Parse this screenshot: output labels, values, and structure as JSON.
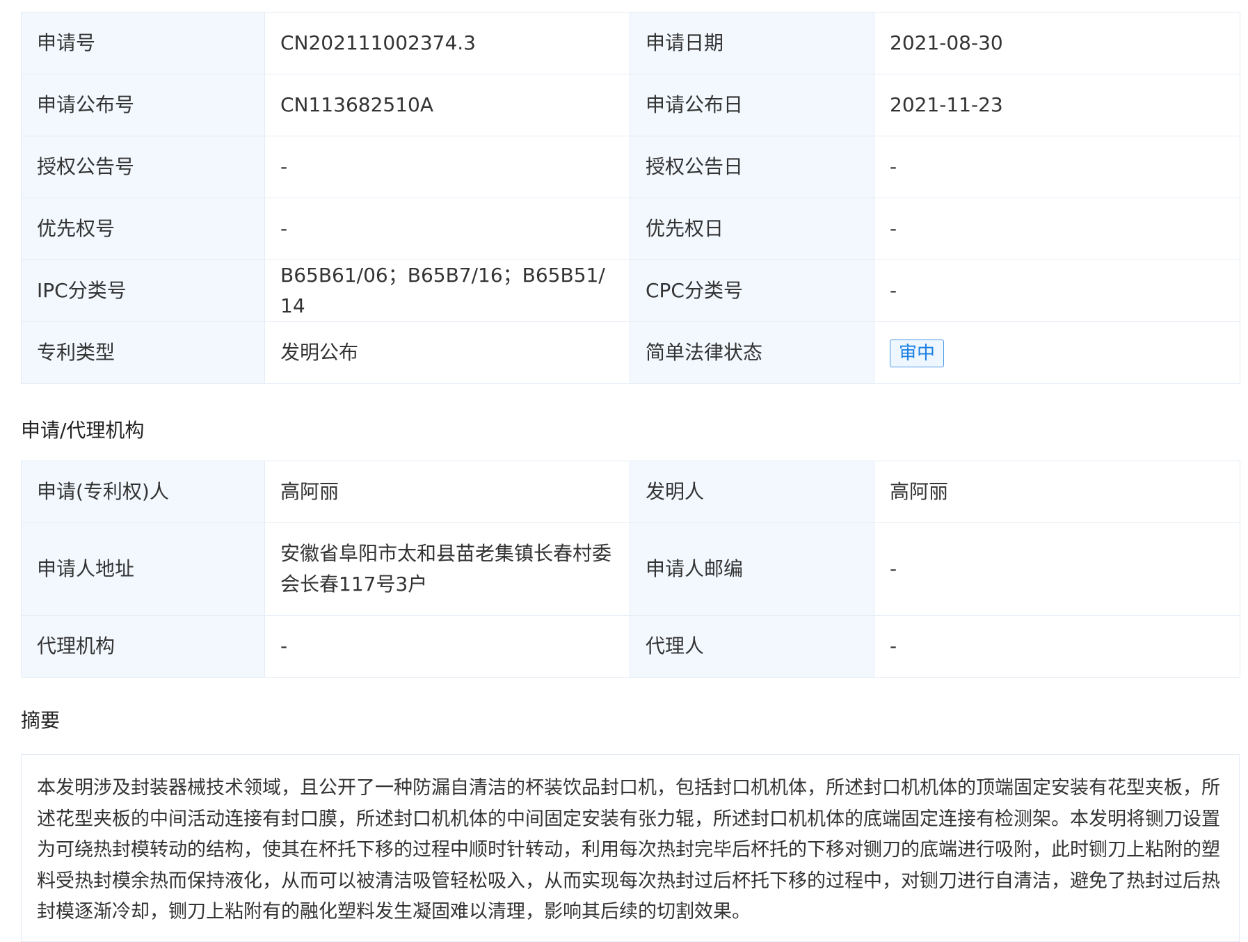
{
  "basic_info": {
    "rows": [
      {
        "l1": "申请号",
        "v1": "CN202111002374.3",
        "l2": "申请日期",
        "v2": "2021-08-30"
      },
      {
        "l1": "申请公布号",
        "v1": "CN113682510A",
        "l2": "申请公布日",
        "v2": "2021-11-23"
      },
      {
        "l1": "授权公告号",
        "v1": "-",
        "l2": "授权公告日",
        "v2": "-"
      },
      {
        "l1": "优先权号",
        "v1": "-",
        "l2": "优先权日",
        "v2": "-"
      },
      {
        "l1": "IPC分类号",
        "v1": "B65B61/06；B65B7/16；B65B51/14",
        "l2": "CPC分类号",
        "v2": "-"
      },
      {
        "l1": "专利类型",
        "v1": "发明公布",
        "l2": "简单法律状态",
        "v2": "审中"
      }
    ]
  },
  "agency_section": {
    "title": "申请/代理机构",
    "rows": [
      {
        "l1": "申请(专利权)人",
        "v1": "高阿丽",
        "l2": "发明人",
        "v2": "高阿丽"
      },
      {
        "l1": "申请人地址",
        "v1": "安徽省阜阳市太和县苗老集镇长春村委会长春117号3户",
        "l2": "申请人邮编",
        "v2": "-"
      },
      {
        "l1": "代理机构",
        "v1": "-",
        "l2": "代理人",
        "v2": "-"
      }
    ]
  },
  "abstract_section": {
    "title": "摘要",
    "text": "本发明涉及封装器械技术领域，且公开了一种防漏自清洁的杯装饮品封口机，包括封口机机体，所述封口机机体的顶端固定安装有花型夹板，所述花型夹板的中间活动连接有封口膜，所述封口机机体的中间固定安装有张力辊，所述封口机机体的底端固定连接有检测架。本发明将铡刀设置为可绕热封模转动的结构，使其在杯托下移的过程中顺时针转动，利用每次热封完毕后杯托的下移对铡刀的底端进行吸附，此时铡刀上粘附的塑料受热封模余热而保持液化，从而可以被清洁吸管轻松吸入，从而实现每次热封过后杯托下移的过程中，对铡刀进行自清洁，避免了热封过后热封模逐渐冷却，铡刀上粘附有的融化塑料发生凝固难以清理，影响其后续的切割效果。"
  },
  "colors": {
    "label_bg": "#f3f8fe",
    "border": "#e4ecf6",
    "status_badge": "#1a7fe0"
  }
}
